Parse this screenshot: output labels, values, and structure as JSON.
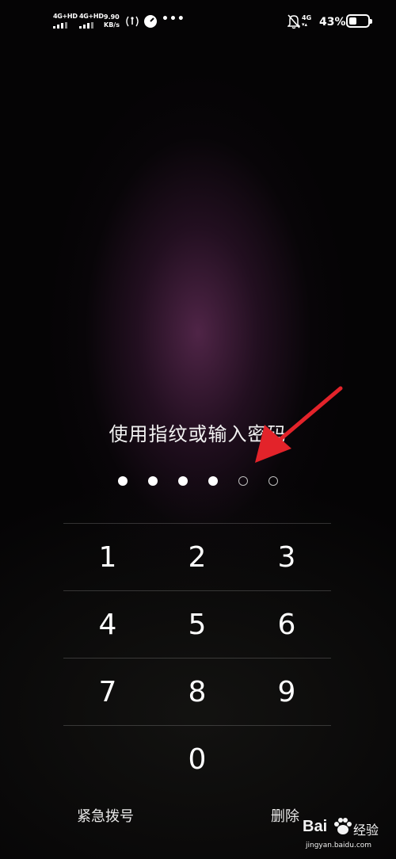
{
  "status_bar": {
    "sim1_network": "4G+HD",
    "sim2_network": "4G+HD",
    "speed_value": "9.90",
    "speed_unit": "KB/s",
    "data_network": "4G",
    "battery_percent": "43%",
    "battery_level": 0.43
  },
  "lockscreen": {
    "prompt": "使用指纹或输入密码",
    "pin_total": 6,
    "pin_entered": 4
  },
  "keypad": {
    "keys": [
      "1",
      "2",
      "3",
      "4",
      "5",
      "6",
      "7",
      "8",
      "9",
      "0"
    ],
    "emergency_label": "紧急拨号",
    "delete_label": "删除"
  },
  "watermark": {
    "brand": "Bai",
    "brand_suffix": "经验",
    "url": "jingyan.baidu.com"
  },
  "colors": {
    "background": "#050405",
    "glow": "#5c2a52",
    "annotation_arrow": "#e3232a"
  }
}
